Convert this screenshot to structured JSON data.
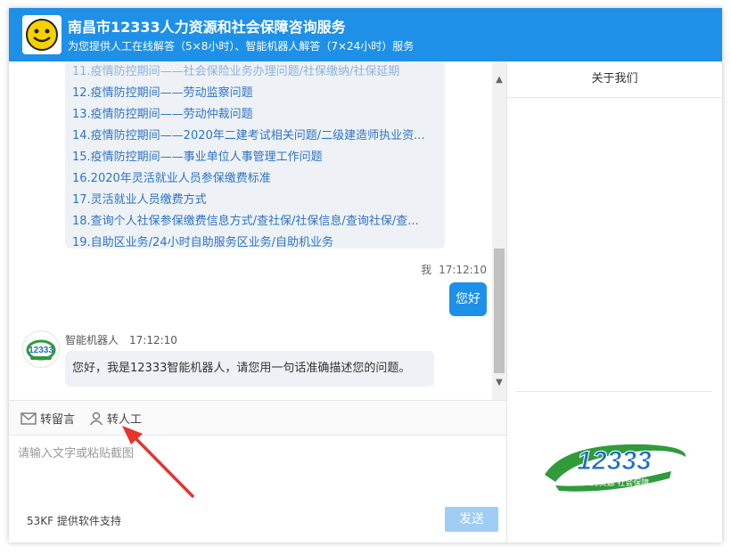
{
  "header": {
    "title": "南昌市12333人力资源和社会保障咨询服务",
    "subtitle": "为您提供人工在线解答（5×8小时）、智能机器人解答（7×24小时）服务",
    "avatar_icon": "smiley-face-icon"
  },
  "chat": {
    "faq_items": [
      "12.疫情防控期间——劳动监察问题",
      "13.疫情防控期间——劳动仲裁问题",
      "14.疫情防控期间——2020年二建考试相关问题/二级建造师执业资...",
      "15.疫情防控期间——事业单位人事管理工作问题",
      "16.2020年灵活就业人员参保缴费标准",
      "17.灵活就业人员缴费方式",
      "18.查询个人社保参保缴费信息方式/查社保/社保信息/查询社保/查...",
      "19.自助区业务/24小时自助服务区业务/自助机业务"
    ],
    "user_name": "我",
    "user_time": "17:12:10",
    "user_message": "您好",
    "bot_name": "智能机器人",
    "bot_time": "17:12:10",
    "bot_message": "您好，我是12333智能机器人，请您用一句话准确描述您的问题。"
  },
  "toolbar": {
    "leave_message": "转留言",
    "transfer_human": "转人工"
  },
  "input": {
    "placeholder": "请输入文字或粘贴截图",
    "powered_by": "53KF 提供软件支持",
    "send_label": "发送"
  },
  "side": {
    "tab_about": "关于我们",
    "logo_text": "12333",
    "logo_slogan": "人力资源 社会保障"
  },
  "colors": {
    "brand_blue": "#1e90e8",
    "link_blue": "#2f73c7",
    "logo_green": "#2f9b3a",
    "arrow_red": "#e8322e"
  }
}
